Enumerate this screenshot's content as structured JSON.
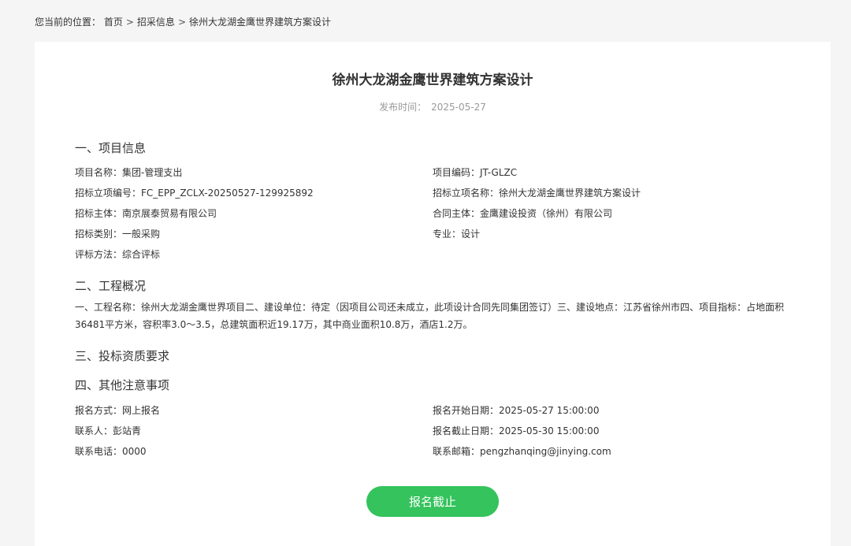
{
  "breadcrumb": {
    "prefix": "您当前的位置：",
    "items": [
      "首页",
      "招采信息",
      "徐州大龙湖金鹰世界建筑方案设计"
    ],
    "separator": ">"
  },
  "article": {
    "title": "徐州大龙湖金鹰世界建筑方案设计",
    "publish_label": "发布时间：",
    "publish_date": "2025-05-27"
  },
  "sections": {
    "project_info": "一、项目信息",
    "overview": "二、工程概况",
    "qualification": "三、投标资质要求",
    "notes": "四、其他注意事项"
  },
  "project_info": {
    "project_name": "项目名称：集团-管理支出",
    "project_code": "项目编码：JT-GLZC",
    "tender_no": "招标立项编号：FC_EPP_ZCLX-20250527-129925892",
    "tender_name": "招标立项名称：徐州大龙湖金鹰世界建筑方案设计",
    "tender_subject": "招标主体：南京展泰贸易有限公司",
    "contract_subject": "合同主体：金鹰建设投资（徐州）有限公司",
    "tender_category": "招标类别：一般采购",
    "specialty": "专业：设计",
    "evaluation": "评标方法：综合评标"
  },
  "overview": {
    "text": "一、工程名称：徐州大龙湖金鹰世界项目二、建设单位：待定（因项目公司还未成立，此项设计合同先同集团签订）三、建设地点：江苏省徐州市四、项目指标：占地面积36481平方米，容积率3.0～3.5，总建筑面积近19.17万，其中商业面积10.8万，酒店1.2万。"
  },
  "notes": {
    "signup_method": "报名方式：网上报名",
    "signup_start": "报名开始日期：2025-05-27 15:00:00",
    "contact": "联系人：彭站青",
    "signup_end": "报名截止日期：2025-05-30 15:00:00",
    "phone": "联系电话：0000",
    "email": "联系邮箱：pengzhanqing@jinying.com"
  },
  "actions": {
    "signup_button": "报名截止",
    "button_color": "#34c35c"
  }
}
